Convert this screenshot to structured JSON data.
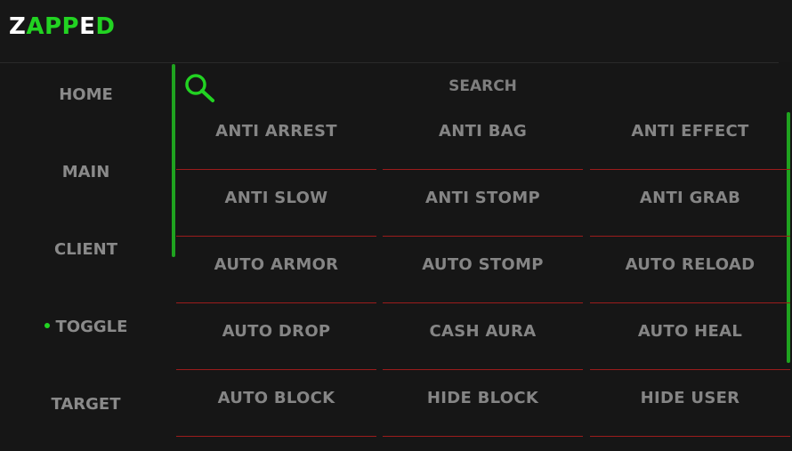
{
  "app": {
    "logo_parts": [
      {
        "text": "Z",
        "color": "#ffffff"
      },
      {
        "text": "A",
        "color": "#22d322"
      },
      {
        "text": "P",
        "color": "#22d322"
      },
      {
        "text": "P",
        "color": "#22d322"
      },
      {
        "text": "E",
        "color": "#ffffff"
      },
      {
        "text": "D",
        "color": "#22d322"
      }
    ]
  },
  "sidebar": {
    "items": [
      {
        "label": "HOME",
        "active": false
      },
      {
        "label": "MAIN",
        "active": false
      },
      {
        "label": "CLIENT",
        "active": false
      },
      {
        "label": "TOGGLE",
        "active": true
      },
      {
        "label": "TARGET",
        "active": false
      }
    ]
  },
  "search": {
    "label": "SEARCH",
    "icon": "search-icon"
  },
  "toggles": {
    "rows": [
      [
        "ANTI ARREST",
        "ANTI BAG",
        "ANTI EFFECT"
      ],
      [
        "ANTI SLOW",
        "ANTI STOMP",
        "ANTI GRAB"
      ],
      [
        "AUTO ARMOR",
        "AUTO STOMP",
        "AUTO RELOAD"
      ],
      [
        "AUTO DROP",
        "CASH AURA",
        "AUTO HEAL"
      ],
      [
        "AUTO BLOCK",
        "HIDE BLOCK",
        "HIDE USER"
      ]
    ]
  },
  "colors": {
    "accent": "#22d322",
    "divider": "#9b1c1c",
    "text": "#858585",
    "background": "#161616"
  }
}
